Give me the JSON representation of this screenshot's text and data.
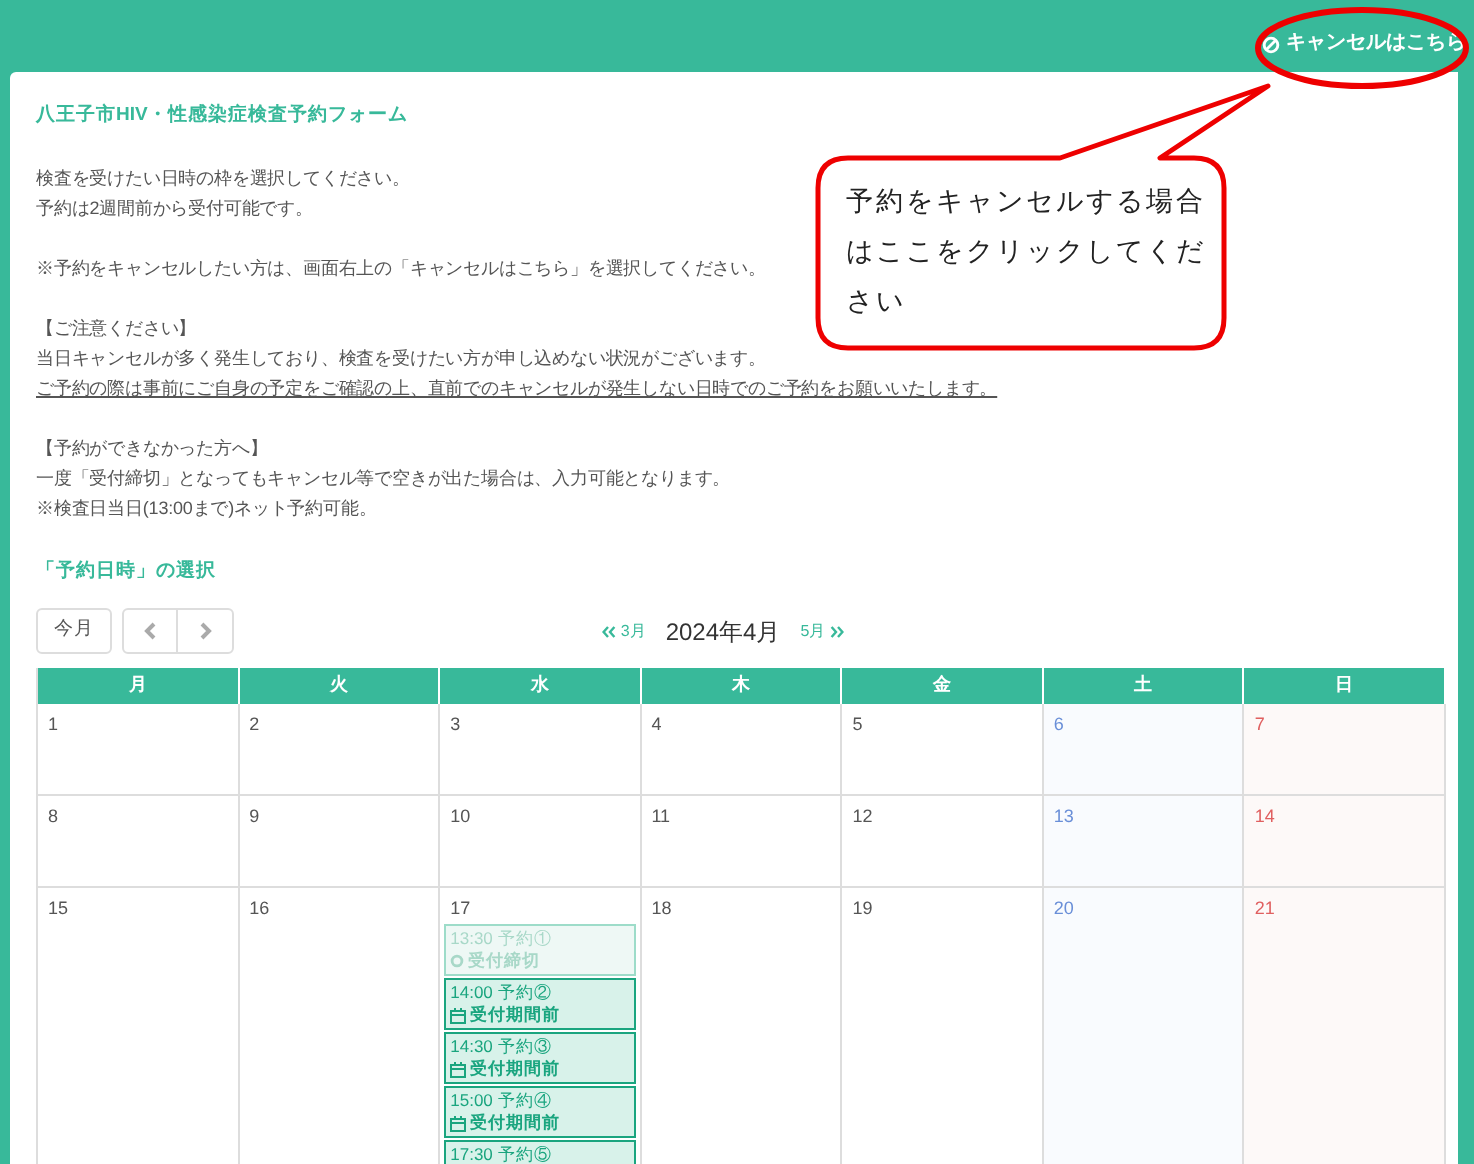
{
  "header": {
    "cancel_link": "キャンセルはこちら"
  },
  "form": {
    "title": "八王子市HIV・性感染症検査予約フォーム",
    "paragraphs": [
      {
        "lines": [
          "検査を受けたい日時の枠を選択してください。",
          "予約は2週間前から受付可能です。"
        ]
      },
      {
        "lines": [
          "※予約をキャンセルしたい方は、画面右上の「キャンセルはこちら」を選択してください。"
        ]
      },
      {
        "lines": [
          "【ご注意ください】",
          "当日キャンセルが多く発生しており、検査を受けたい方が申し込めない状況がございます。"
        ],
        "underlined_line": "ご予約の際は事前にご自身の予定をご確認の上、直前でのキャンセルが発生しない日時でのご予約をお願いいたします。"
      },
      {
        "lines": [
          "【予約ができなかった方へ】",
          "一度「受付締切」となってもキャンセル等で空きが出た場合は、入力可能となります。",
          "※検査日当日(13:00まで)ネット予約可能。"
        ]
      }
    ],
    "section_title": "「予約日時」の選択"
  },
  "calendar": {
    "today_button": "今月",
    "prev_month": "3月",
    "next_month": "5月",
    "title": "2024年4月",
    "weekdays": [
      {
        "label": "月"
      },
      {
        "label": "火"
      },
      {
        "label": "水"
      },
      {
        "label": "木"
      },
      {
        "label": "金"
      },
      {
        "label": "土"
      },
      {
        "label": "日"
      }
    ],
    "weeks": [
      {
        "days": [
          {
            "number": "1",
            "kind": "weekday"
          },
          {
            "number": "2",
            "kind": "weekday"
          },
          {
            "number": "3",
            "kind": "weekday"
          },
          {
            "number": "4",
            "kind": "weekday"
          },
          {
            "number": "5",
            "kind": "weekday"
          },
          {
            "number": "6",
            "kind": "saturday"
          },
          {
            "number": "7",
            "kind": "sunday"
          }
        ]
      },
      {
        "days": [
          {
            "number": "8",
            "kind": "weekday"
          },
          {
            "number": "9",
            "kind": "weekday"
          },
          {
            "number": "10",
            "kind": "weekday"
          },
          {
            "number": "11",
            "kind": "weekday"
          },
          {
            "number": "12",
            "kind": "weekday"
          },
          {
            "number": "13",
            "kind": "saturday"
          },
          {
            "number": "14",
            "kind": "sunday"
          }
        ]
      },
      {
        "days": [
          {
            "number": "15",
            "kind": "weekday"
          },
          {
            "number": "16",
            "kind": "weekday"
          },
          {
            "number": "17",
            "kind": "weekday",
            "events": [
              {
                "time": "13:30 予約①",
                "status": "受付締切",
                "kind": "closed"
              },
              {
                "time": "14:00 予約②",
                "status": "受付期間前",
                "kind": "not_yet_open"
              },
              {
                "time": "14:30 予約③",
                "status": "受付期間前",
                "kind": "not_yet_open"
              },
              {
                "time": "15:00 予約④",
                "status": "受付期間前",
                "kind": "not_yet_open"
              },
              {
                "time": "17:30 予約⑤",
                "kind": "not_yet_open"
              }
            ]
          },
          {
            "number": "18",
            "kind": "weekday"
          },
          {
            "number": "19",
            "kind": "weekday"
          },
          {
            "number": "20",
            "kind": "saturday"
          },
          {
            "number": "21",
            "kind": "sunday"
          }
        ]
      }
    ]
  },
  "callout": {
    "text": "予約をキャンセルする場合はここをクリックしてください"
  }
}
